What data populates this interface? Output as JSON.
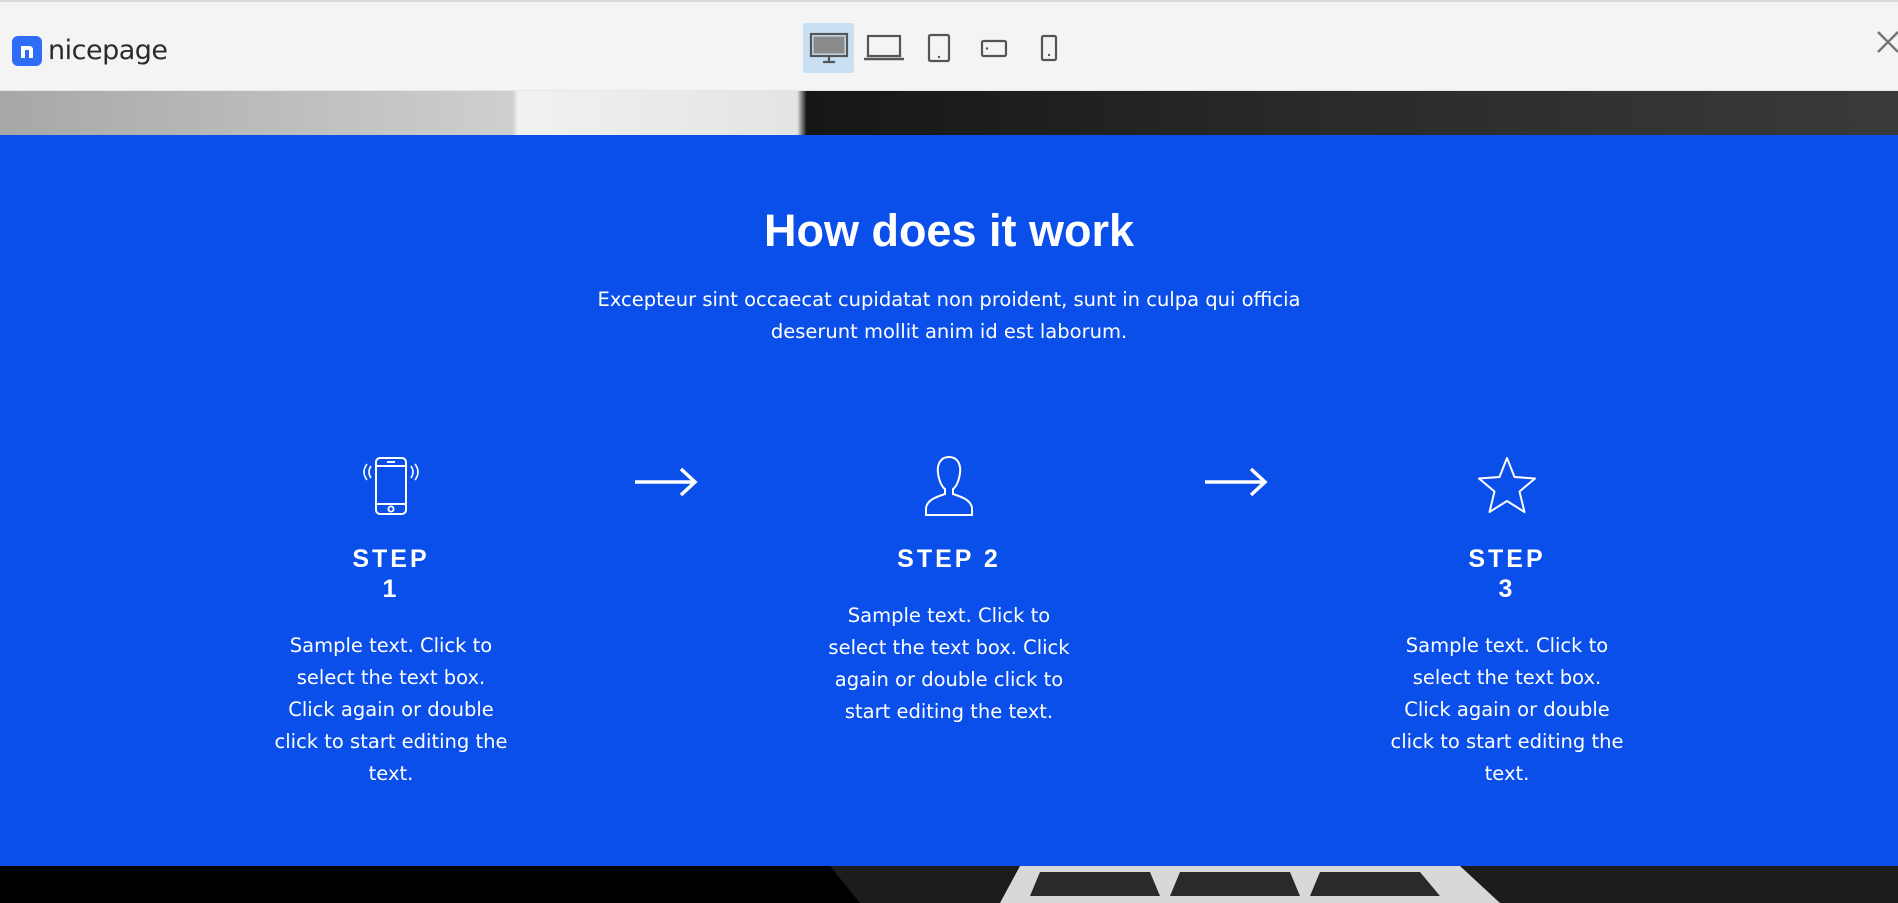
{
  "app": {
    "logo_text": "nicepage",
    "brand_color": "#2f6df6"
  },
  "toolbar": {
    "devices": [
      {
        "name": "desktop",
        "icon": "desktop-monitor-icon",
        "active": true
      },
      {
        "name": "laptop",
        "icon": "laptop-icon",
        "active": false
      },
      {
        "name": "tablet",
        "icon": "tablet-icon",
        "active": false
      },
      {
        "name": "phone-landscape",
        "icon": "phone-landscape-icon",
        "active": false
      },
      {
        "name": "phone-portrait",
        "icon": "phone-portrait-icon",
        "active": false
      }
    ],
    "close_icon": "close-icon"
  },
  "section": {
    "background_color": "#0a4fea",
    "title": "How does it work",
    "subtitle": "Excepteur sint occaecat cupidatat non proident, sunt in culpa qui officia deserunt mollit anim id est laborum.",
    "steps": [
      {
        "icon": "smartphone-icon",
        "title_line1": "STEP",
        "title_line2": "1",
        "text": "Sample text. Click to select the text box. Click again or double click to start editing the text."
      },
      {
        "icon": "user-icon",
        "title": "STEP 2",
        "text": "Sample text. Click to select the text box. Click again or double click to start editing the text."
      },
      {
        "icon": "star-icon",
        "title_line1": "STEP",
        "title_line2": "3",
        "text": "Sample text. Click to select the text box. Click again or double click to start editing the text."
      }
    ],
    "arrow_icon": "arrow-right-icon"
  }
}
